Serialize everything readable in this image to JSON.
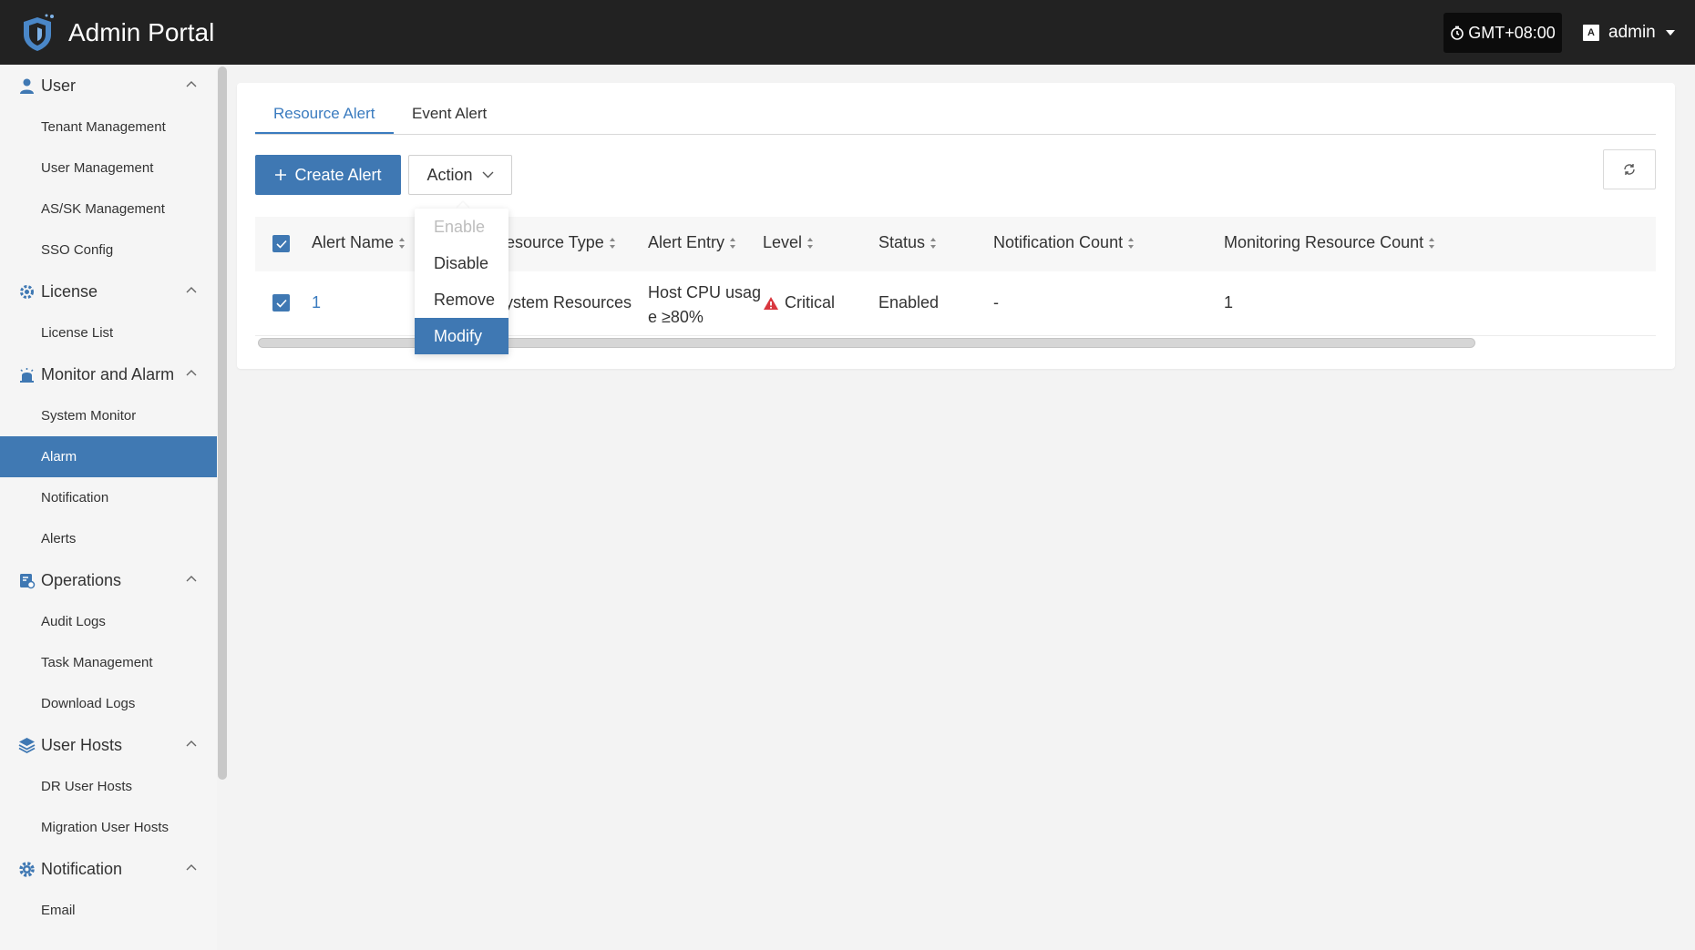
{
  "app": {
    "title": "Admin Portal",
    "timezone": "GMT+08:00",
    "user": "admin",
    "accent_color": "#3f78b3",
    "topbar_color": "#222222"
  },
  "sidebar": {
    "groups": [
      {
        "label": "User",
        "icon": "user-icon",
        "items": [
          "Tenant Management",
          "User Management",
          "AS/SK Management",
          "SSO Config"
        ]
      },
      {
        "label": "License",
        "icon": "license-gear-icon",
        "items": [
          "License List"
        ]
      },
      {
        "label": "Monitor and Alarm",
        "icon": "alarm-monitor-icon",
        "items": [
          "System Monitor",
          "Alarm",
          "Notification",
          "Alerts"
        ]
      },
      {
        "label": "Operations",
        "icon": "operations-icon",
        "items": [
          "Audit Logs",
          "Task Management",
          "Download Logs"
        ]
      },
      {
        "label": "User Hosts",
        "icon": "layers-icon",
        "items": [
          "DR User Hosts",
          "Migration User Hosts"
        ]
      },
      {
        "label": "Notification",
        "icon": "gear-icon",
        "items": [
          "Email"
        ]
      }
    ],
    "active_item": "Alarm"
  },
  "tabs": [
    {
      "label": "Resource Alert",
      "active": true
    },
    {
      "label": "Event Alert",
      "active": false
    }
  ],
  "toolbar": {
    "create_label": "Create Alert",
    "action_label": "Action"
  },
  "table": {
    "columns": [
      "Alert Name",
      "Resource Type",
      "Alert Entry",
      "Level",
      "Status",
      "Notification Count",
      "Monitoring Resource Count"
    ],
    "rows": [
      {
        "alert_name": "1",
        "resource_type": "System Resources",
        "alert_entry_line1": "Host CPU usag",
        "alert_entry_line2": "e ≥80%",
        "level": "Critical",
        "status": "Enabled",
        "notification_count": "-",
        "monitoring_resource_count": "1",
        "checked": true
      }
    ]
  },
  "action_menu": {
    "items": [
      {
        "label": "Enable",
        "state": "disabled"
      },
      {
        "label": "Disable",
        "state": "normal"
      },
      {
        "label": "Remove",
        "state": "normal"
      },
      {
        "label": "Modify",
        "state": "hover"
      }
    ]
  }
}
